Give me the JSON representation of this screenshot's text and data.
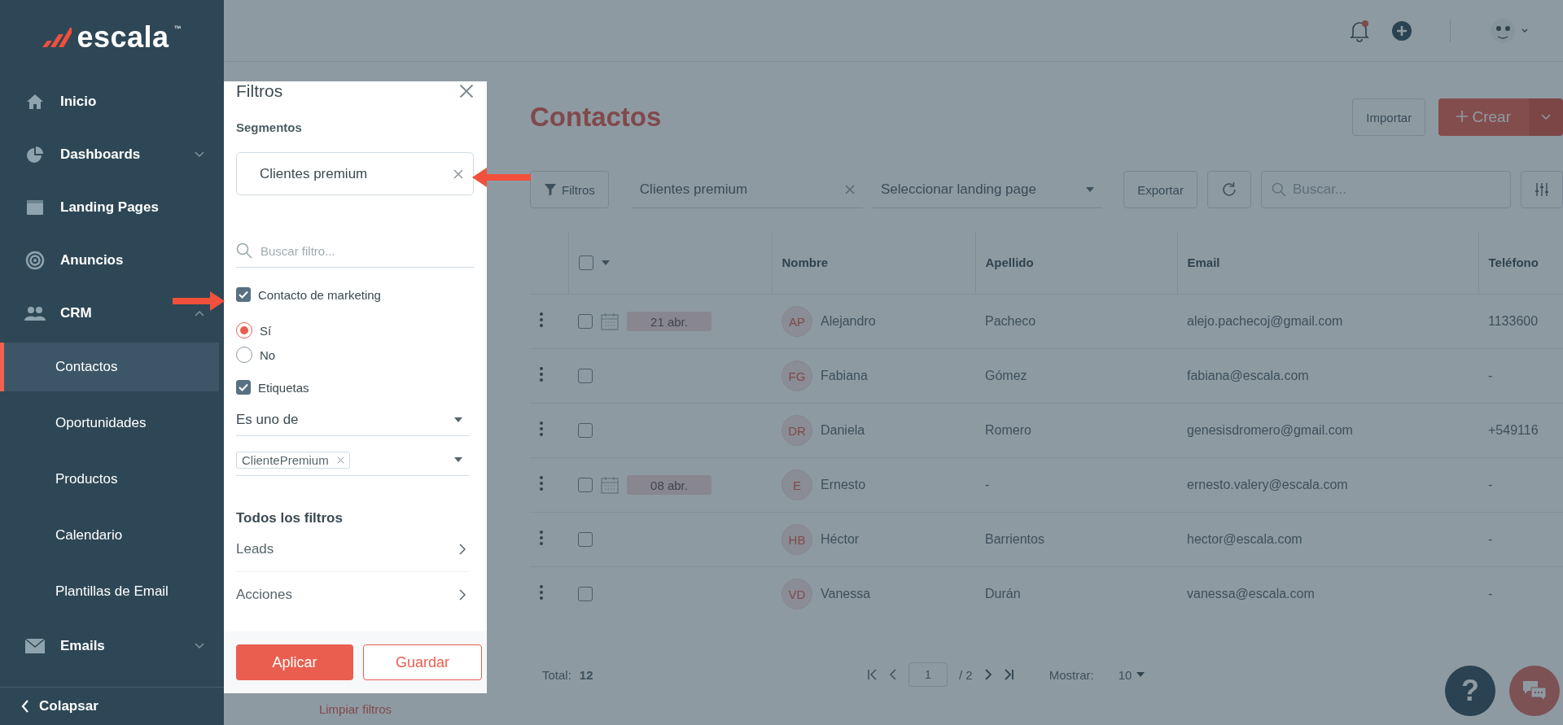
{
  "sidebar": {
    "logo": "escala",
    "logo_mark": "™",
    "items": [
      {
        "label": "Inicio",
        "kind": "link"
      },
      {
        "label": "Dashboards",
        "kind": "group",
        "expanded": false
      },
      {
        "label": "Landing Pages",
        "kind": "link"
      },
      {
        "label": "Anuncios",
        "kind": "link"
      },
      {
        "label": "CRM",
        "kind": "group",
        "expanded": true,
        "children": [
          {
            "label": "Contactos",
            "selected": true
          },
          {
            "label": "Oportunidades",
            "selected": false
          },
          {
            "label": "Productos",
            "selected": false
          },
          {
            "label": "Calendario",
            "selected": false
          },
          {
            "label": "Plantillas de Email",
            "selected": false
          }
        ]
      },
      {
        "label": "Emails",
        "kind": "group",
        "expanded": false
      }
    ],
    "collapse": "Colapsar"
  },
  "page": {
    "title": "Contactos",
    "import_button": "Importar",
    "create_button": "Crear"
  },
  "toolbar": {
    "filters_button": "Filtros",
    "segment": "Clientes premium",
    "landing_placeholder": "Seleccionar landing page",
    "export_button": "Exportar",
    "search_placeholder": "Buscar..."
  },
  "table": {
    "select_all_checked": false,
    "columns": [
      "Nombre",
      "Apellido",
      "Email",
      "Teléfono"
    ],
    "rows": [
      {
        "checked": false,
        "date": "21 abr.",
        "initials": "AP",
        "name": "Alejandro",
        "surname": "Pacheco",
        "email": "alejo.pachecoj@gmail.com",
        "phone": "1133600"
      },
      {
        "checked": false,
        "initials": "FG",
        "name": "Fabiana",
        "surname": "Gómez",
        "email": "fabiana@escala.com",
        "phone": "-"
      },
      {
        "checked": false,
        "initials": "DR",
        "name": "Daniela",
        "surname": "Romero",
        "email": "genesisdromero@gmail.com",
        "phone": "+549116"
      },
      {
        "checked": false,
        "date": "08 abr.",
        "initials": "E",
        "name": "Ernesto",
        "surname": "-",
        "email": "ernesto.valery@escala.com",
        "phone": "-"
      },
      {
        "checked": false,
        "initials": "HB",
        "name": "Héctor",
        "surname": "Barrientos",
        "email": "hector@escala.com",
        "phone": "-"
      },
      {
        "checked": false,
        "initials": "VD",
        "name": "Vanessa",
        "surname": "Durán",
        "email": "vanessa@escala.com",
        "phone": "-"
      }
    ]
  },
  "footer": {
    "total_label": "Total:",
    "total": "12",
    "page": "1",
    "pages": "/ 2",
    "show_label": "Mostrar:",
    "page_size": "10"
  },
  "help_button": "?",
  "filter_panel": {
    "title": "Filtros",
    "segments_label": "Segmentos",
    "segment": "Clientes premium",
    "search_placeholder": "Buscar filtro...",
    "filters": [
      {
        "kind": "checkbox",
        "label": "Contacto de marketing",
        "checked": true
      },
      {
        "kind": "radio",
        "label": "Sí",
        "selected": true
      },
      {
        "kind": "radio",
        "label": "No",
        "selected": false
      },
      {
        "kind": "checkbox",
        "label": "Etiquetas",
        "checked": true
      },
      {
        "kind": "select",
        "value": "Es uno de"
      },
      {
        "kind": "tags",
        "tags": [
          "ClientePremium"
        ]
      }
    ],
    "all_filters_title": "Todos los filtros",
    "categories": [
      "Leads",
      "Acciones"
    ],
    "apply_button": "Aplicar",
    "save_button": "Guardar",
    "clear_link": "Limpiar filtros"
  }
}
